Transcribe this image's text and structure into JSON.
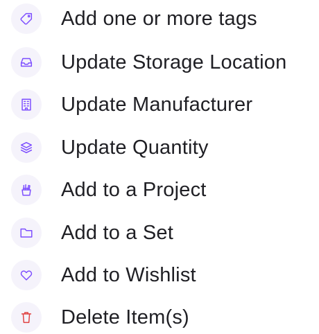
{
  "menu": {
    "items": [
      {
        "label": "Add one or more tags",
        "icon": "tag-icon"
      },
      {
        "label": "Update Storage Location",
        "icon": "inbox-icon"
      },
      {
        "label": "Update Manufacturer",
        "icon": "building-icon"
      },
      {
        "label": "Update Quantity",
        "icon": "stack-icon"
      },
      {
        "label": "Add to a Project",
        "icon": "pencil-cup-icon"
      },
      {
        "label": "Add to a Set",
        "icon": "folder-icon"
      },
      {
        "label": "Add to Wishlist",
        "icon": "heart-icon"
      },
      {
        "label": "Delete Item(s)",
        "icon": "trash-icon"
      }
    ]
  },
  "colors": {
    "icon_accent": "#7c4dff",
    "delete_accent": "#e04141",
    "icon_background": "#f5f3fb",
    "text": "#1f1f24"
  }
}
